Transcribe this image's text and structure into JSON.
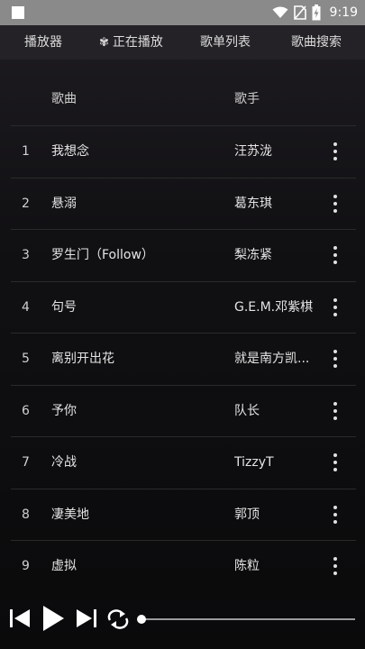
{
  "status_bar": {
    "time": "9:19"
  },
  "tabs": [
    {
      "label": "播放器",
      "icon": ""
    },
    {
      "label": "正在播放",
      "icon": "flower-icon"
    },
    {
      "label": "歌单列表",
      "icon": ""
    },
    {
      "label": "歌曲搜索",
      "icon": ""
    }
  ],
  "table": {
    "headers": {
      "song": "歌曲",
      "artist": "歌手"
    },
    "rows": [
      {
        "num": "1",
        "song": "我想念",
        "artist": "汪苏泷"
      },
      {
        "num": "2",
        "song": "悬溺",
        "artist": "葛东琪"
      },
      {
        "num": "3",
        "song": "罗生门（Follow）",
        "artist": "梨冻紧"
      },
      {
        "num": "4",
        "song": "句号",
        "artist": "G.E.M.邓紫棋"
      },
      {
        "num": "5",
        "song": "离别开出花",
        "artist": "就是南方凯..."
      },
      {
        "num": "6",
        "song": "予你",
        "artist": "队长"
      },
      {
        "num": "7",
        "song": "冷战",
        "artist": "TizzyT"
      },
      {
        "num": "8",
        "song": "凄美地",
        "artist": "郭顶"
      },
      {
        "num": "9",
        "song": "虚拟",
        "artist": "陈粒"
      }
    ]
  },
  "player": {
    "progress": 0
  },
  "colors": {
    "status_bar": "#8a8a8a",
    "background": "#111013",
    "accent": "#ffffff"
  }
}
